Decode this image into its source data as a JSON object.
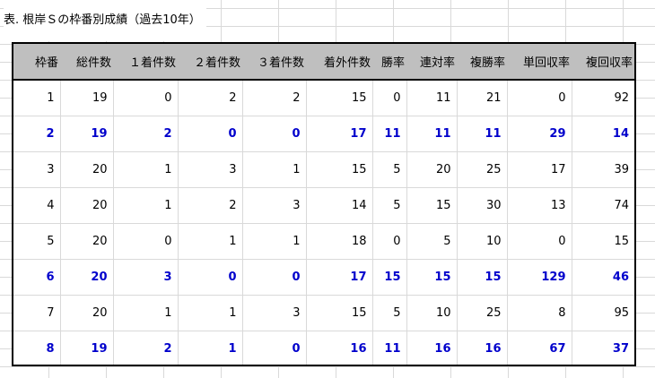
{
  "caption": "表. 根岸Ｓの枠番別成績（過去10年）",
  "table": {
    "headers": [
      "枠番",
      "総件数",
      "１着件数",
      "２着件数",
      "３着件数",
      "着外件数",
      "勝率",
      "連対率",
      "複勝率",
      "単回収率",
      "複回収率"
    ],
    "rows": [
      {
        "highlight": false,
        "cells": [
          "1",
          "19",
          "0",
          "2",
          "2",
          "15",
          "0",
          "11",
          "21",
          "0",
          "92"
        ]
      },
      {
        "highlight": true,
        "cells": [
          "2",
          "19",
          "2",
          "0",
          "0",
          "17",
          "11",
          "11",
          "11",
          "29",
          "14"
        ]
      },
      {
        "highlight": false,
        "cells": [
          "3",
          "20",
          "1",
          "3",
          "1",
          "15",
          "5",
          "20",
          "25",
          "17",
          "39"
        ]
      },
      {
        "highlight": false,
        "cells": [
          "4",
          "20",
          "1",
          "2",
          "3",
          "14",
          "5",
          "15",
          "30",
          "13",
          "74"
        ]
      },
      {
        "highlight": false,
        "cells": [
          "5",
          "20",
          "0",
          "1",
          "1",
          "18",
          "0",
          "5",
          "10",
          "0",
          "15"
        ]
      },
      {
        "highlight": true,
        "cells": [
          "6",
          "20",
          "3",
          "0",
          "0",
          "17",
          "15",
          "15",
          "15",
          "129",
          "46"
        ]
      },
      {
        "highlight": false,
        "cells": [
          "7",
          "20",
          "1",
          "1",
          "3",
          "15",
          "5",
          "10",
          "25",
          "8",
          "95"
        ]
      },
      {
        "highlight": true,
        "cells": [
          "8",
          "19",
          "2",
          "1",
          "0",
          "16",
          "11",
          "16",
          "16",
          "67",
          "37"
        ]
      }
    ]
  },
  "colors": {
    "header_bg": "#bfbfbf",
    "highlight_text": "#0000cc",
    "border": "#000000",
    "gridline": "#d9d9d9"
  }
}
